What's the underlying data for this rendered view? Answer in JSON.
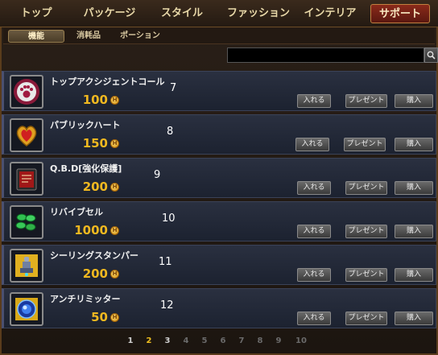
{
  "top_nav": {
    "tabs": [
      {
        "label": "トップ"
      },
      {
        "label": "パッケージ"
      },
      {
        "label": "スタイル"
      },
      {
        "label": "ファッション"
      },
      {
        "label": "インテリア"
      },
      {
        "label": "サポート",
        "active": true
      }
    ]
  },
  "sub_nav": {
    "tabs": [
      {
        "label": "機能",
        "active": true
      },
      {
        "label": "消耗品"
      },
      {
        "label": "ポーション"
      }
    ]
  },
  "search": {
    "value": "",
    "icon": "search-icon"
  },
  "currency_icon_letter": "H",
  "buttons": {
    "put_in": "入れる",
    "present": "プレゼント",
    "buy": "購入"
  },
  "items": [
    {
      "name": "トップアクシジェントコール",
      "price": "100",
      "num": "7",
      "icon": "paw-emblem-icon"
    },
    {
      "name": "パブリックハート",
      "price": "150",
      "num": "8",
      "icon": "gold-heart-icon"
    },
    {
      "name": "Q.B.D[強化保護]",
      "price": "200",
      "num": "9",
      "icon": "red-book-icon"
    },
    {
      "name": "リバイブセル",
      "price": "1000",
      "num": "10",
      "icon": "green-cells-icon"
    },
    {
      "name": "シーリングスタンパー",
      "price": "200",
      "num": "11",
      "icon": "stamper-icon"
    },
    {
      "name": "アンチリミッター",
      "price": "50",
      "num": "12",
      "icon": "blue-orb-icon"
    }
  ],
  "pagination": {
    "pages": [
      "1",
      "2",
      "3",
      "4",
      "5",
      "6",
      "7",
      "8",
      "9",
      "10"
    ],
    "current": "2"
  },
  "colors": {
    "price": "#f0b820",
    "active_tab": "#8a2a1a",
    "item_bg": "#2a3040"
  }
}
